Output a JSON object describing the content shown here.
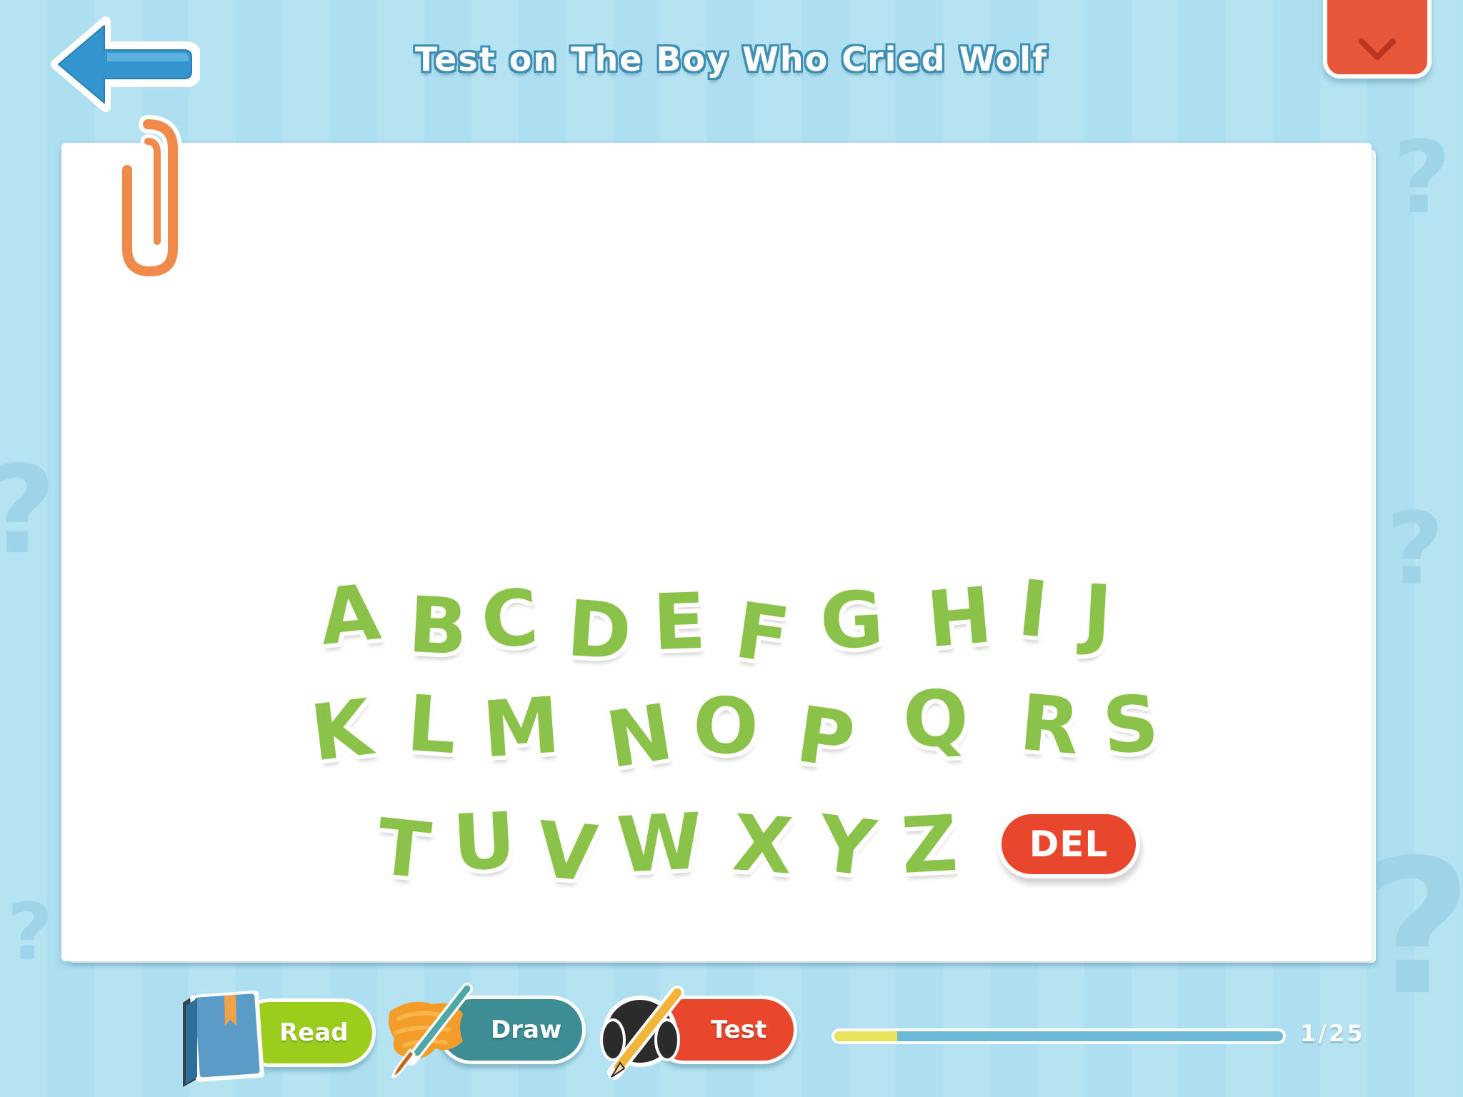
{
  "header": {
    "title": "Test on The Boy Who Cried Wolf",
    "back_icon": "back-arrow-icon",
    "menu_icon": "chevron-down-icon"
  },
  "keyboard": {
    "letters": [
      "A",
      "B",
      "C",
      "D",
      "E",
      "F",
      "G",
      "H",
      "I",
      "J",
      "K",
      "L",
      "M",
      "N",
      "O",
      "P",
      "Q",
      "R",
      "S",
      "T",
      "U",
      "V",
      "W",
      "X",
      "Y",
      "Z"
    ],
    "delete_label": "DEL"
  },
  "toolbar": {
    "read_label": "Read",
    "draw_label": "Draw",
    "test_label": "Test",
    "read_icon": "book-icon",
    "draw_icon": "paintbrush-icon",
    "test_icon": "pencil-icon"
  },
  "progress": {
    "text": "1/25",
    "fraction": 0.04
  },
  "colors": {
    "background": "#b5e3f2",
    "letter_green": "#8bc34a",
    "accent_red": "#e9472d",
    "read_green": "#9ccc1c",
    "draw_teal": "#3d8d94",
    "title_outline": "#3f8fb4"
  }
}
